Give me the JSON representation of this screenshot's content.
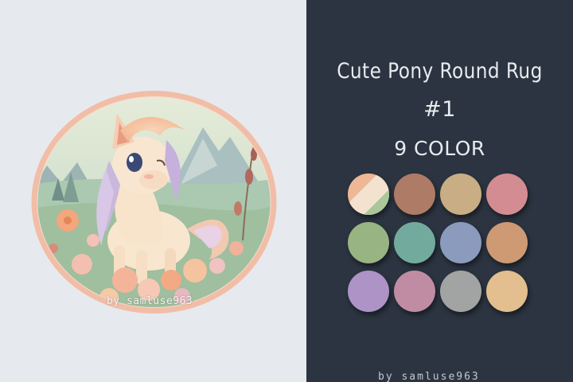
{
  "product": {
    "title_line1": "Cute Pony Round Rug",
    "title_line2": "#1",
    "title_line3": "9 COLOR"
  },
  "watermark_left": "by samluse963",
  "watermark_right": "by samluse963",
  "colors": {
    "left_background": "#e6eaef",
    "right_background": "#2b3440",
    "rug_border": "#f2bda7"
  },
  "swatches": [
    {
      "name": "mixed",
      "colors": [
        "#eeb896",
        "#f3e2cf",
        "#a9c79b"
      ]
    },
    {
      "name": "brown",
      "color": "#ae7b66"
    },
    {
      "name": "tan",
      "color": "#c8ad85"
    },
    {
      "name": "pink",
      "color": "#d48c93"
    },
    {
      "name": "green",
      "color": "#98b482"
    },
    {
      "name": "teal",
      "color": "#72ab9e"
    },
    {
      "name": "blue",
      "color": "#8b9bbd"
    },
    {
      "name": "orange",
      "color": "#cd9a73"
    },
    {
      "name": "lavender",
      "color": "#ad93c6"
    },
    {
      "name": "mauve",
      "color": "#c08ca4"
    },
    {
      "name": "gray",
      "color": "#a2a4a3"
    },
    {
      "name": "peach",
      "color": "#e3be8e"
    }
  ]
}
